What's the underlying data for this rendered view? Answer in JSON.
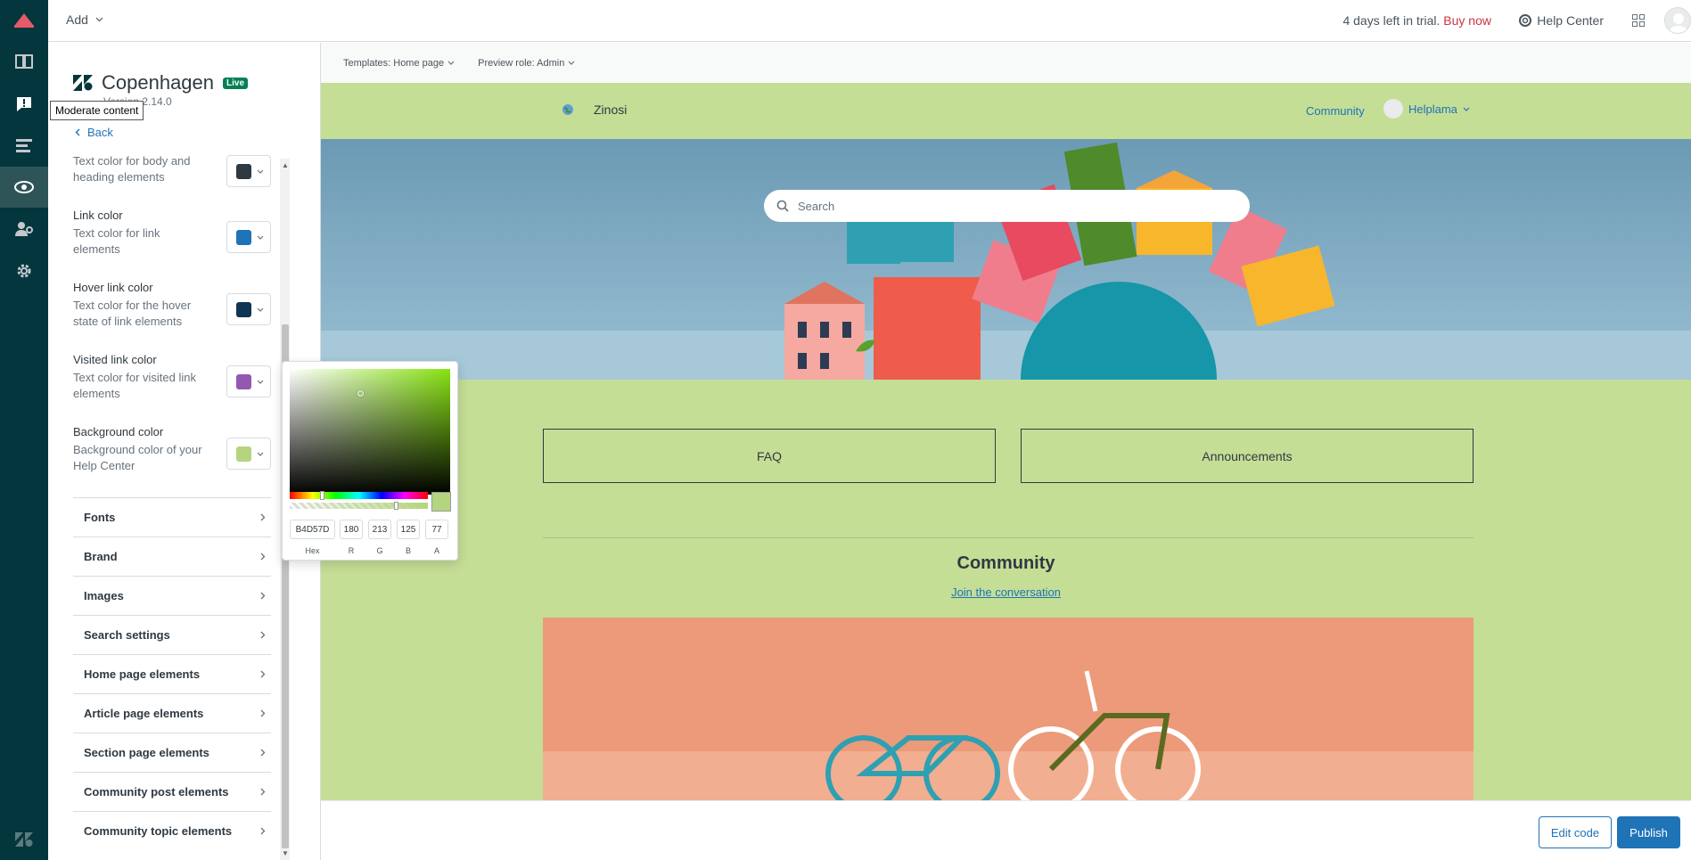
{
  "topbar": {
    "add_label": "Add",
    "trial_text": "4 days left in trial.",
    "buy_now": "Buy now",
    "help_center": "Help Center"
  },
  "tooltip": "Moderate content",
  "panel": {
    "theme_name": "Copenhagen",
    "live_badge": "Live",
    "version": "Version 2.14.0",
    "back": "Back",
    "color_settings": [
      {
        "title": "",
        "desc": "Text color for body and heading elements",
        "color": "#2f3941"
      },
      {
        "title": "Link color",
        "desc": "Text color for link elements",
        "color": "#1f73b7"
      },
      {
        "title": "Hover link color",
        "desc": "Text color for the hover state of link elements",
        "color": "#0f3554"
      },
      {
        "title": "Visited link color",
        "desc": "Text color for visited link elements",
        "color": "#9358b0"
      },
      {
        "title": "Background color",
        "desc": "Background color of your Help Center",
        "color": "#b4d57d"
      }
    ],
    "sections": [
      "Fonts",
      "Brand",
      "Images",
      "Search settings",
      "Home page elements",
      "Article page elements",
      "Section page elements",
      "Community post elements",
      "Community topic elements"
    ]
  },
  "picker": {
    "hex": "B4D57D",
    "r": "180",
    "g": "213",
    "b": "125",
    "a": "77",
    "labels": {
      "hex": "Hex",
      "r": "R",
      "g": "G",
      "b": "B",
      "a": "A"
    }
  },
  "preview": {
    "template": "Templates: Home page",
    "role": "Preview role: Admin",
    "brand": "Zinosi",
    "community": "Community",
    "user": "Helplama",
    "search_placeholder": "Search",
    "faq": "FAQ",
    "announcements": "Announcements",
    "community_title": "Community",
    "community_sub": "Join the conversation"
  },
  "footer": {
    "edit_code": "Edit code",
    "publish": "Publish"
  }
}
